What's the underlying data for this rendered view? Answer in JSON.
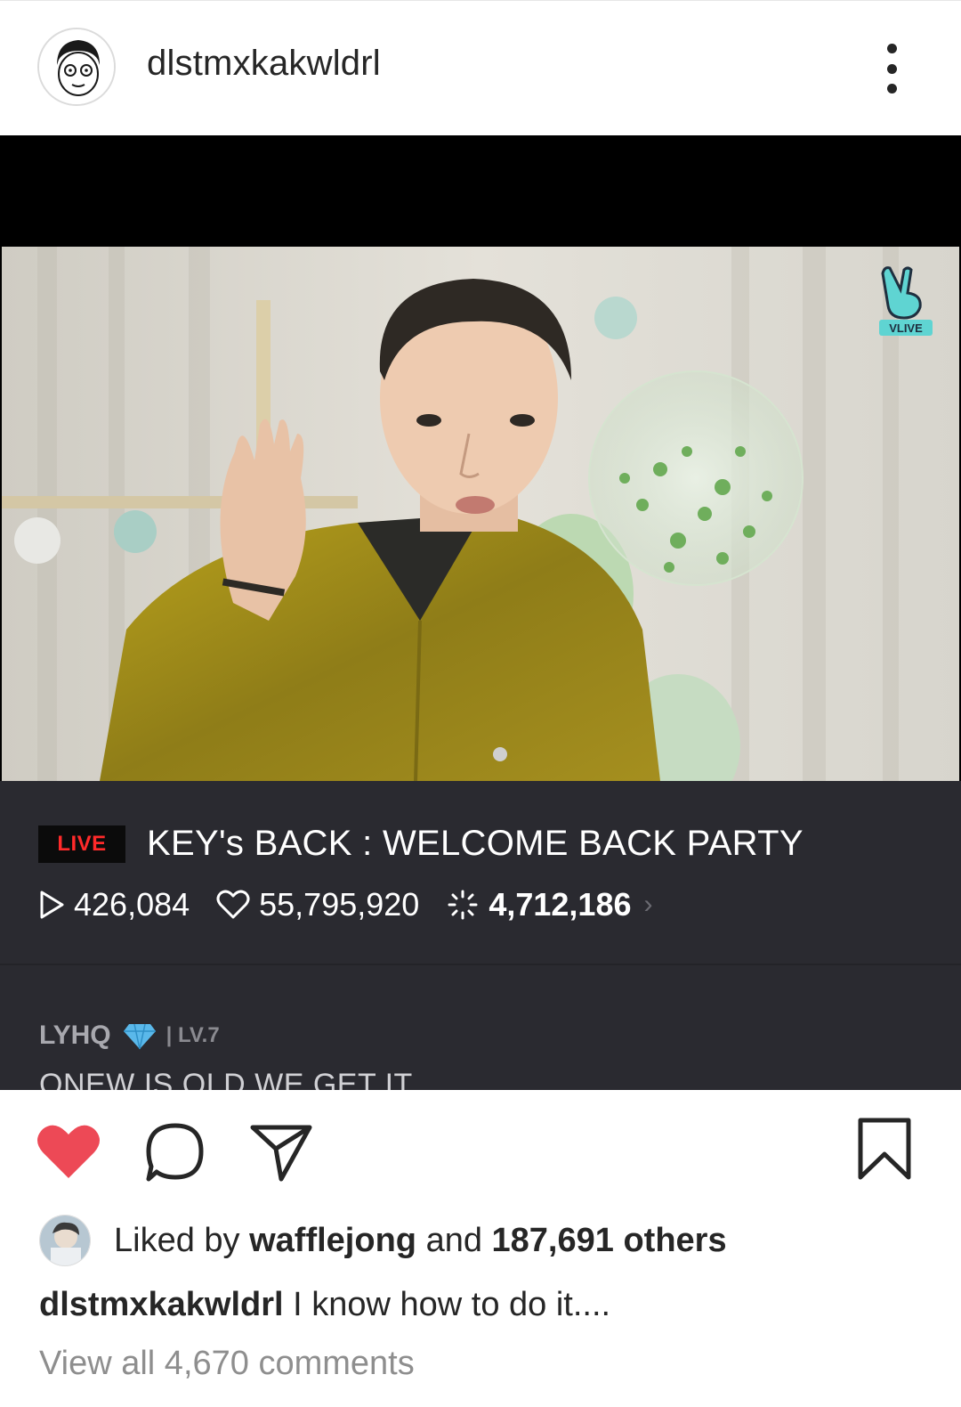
{
  "post": {
    "username": "dlstmxkakwldrl",
    "more_icon": "more-vertical-icon"
  },
  "media": {
    "brand_badge": "VLIVE",
    "live_label": "LIVE",
    "stream_title": "KEY's BACK : WELCOME BACK PARTY",
    "plays": "426,084",
    "hearts": "55,795,920",
    "sparkles": "4,712,186",
    "chat": {
      "user": "LYHQ",
      "level": "| LV.7",
      "message": "ONEW IS OLD WE GET IT"
    }
  },
  "actions": {
    "icons": [
      "heart-filled-icon",
      "comment-icon",
      "share-icon",
      "bookmark-icon"
    ],
    "like_color": "#ed4956"
  },
  "likes": {
    "prefix": "Liked by",
    "liker": "wafflejong",
    "connector": "and",
    "others": "187,691 others"
  },
  "caption": {
    "username": "dlstmxkakwldrl",
    "text": "I know how to do it...."
  },
  "comments": {
    "view_all": "View all 4,670 comments"
  }
}
